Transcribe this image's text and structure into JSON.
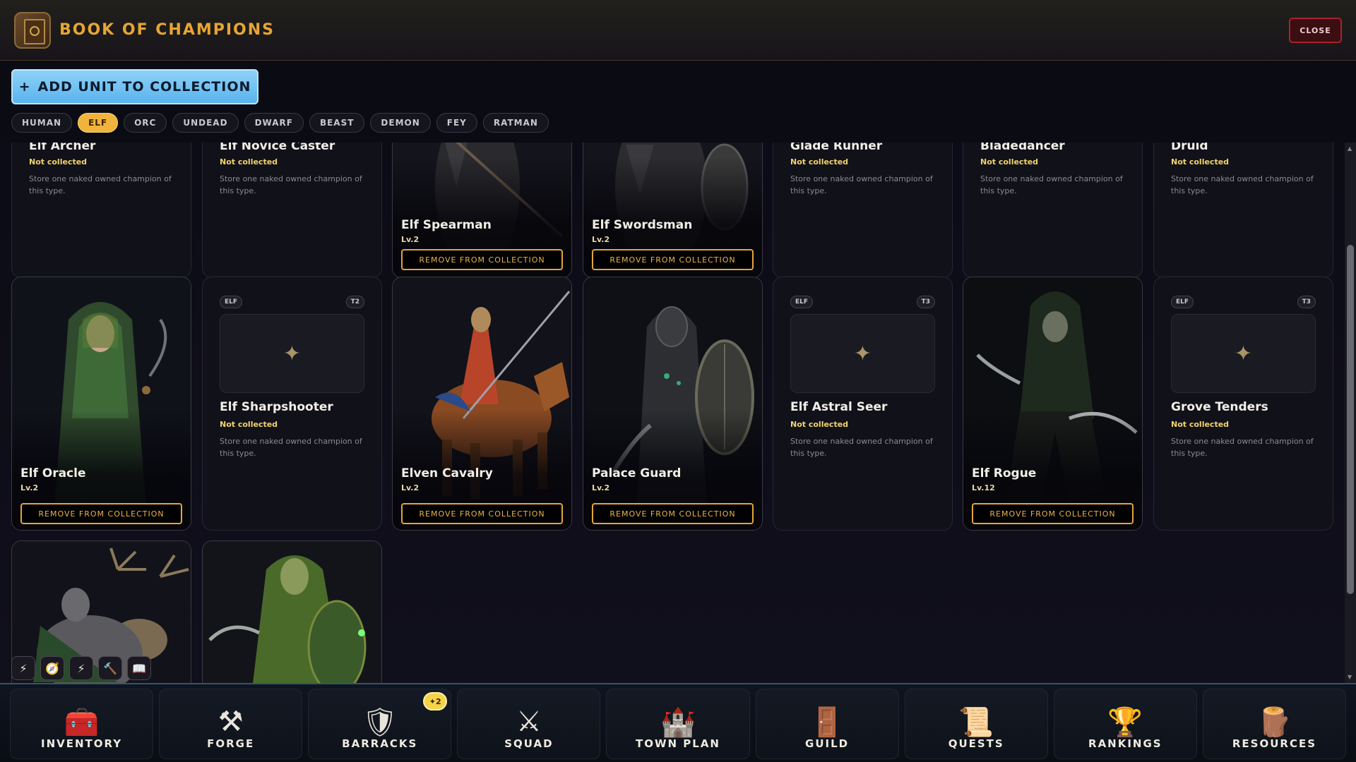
{
  "header": {
    "title": "BOOK OF CHAMPIONS",
    "close_label": "CLOSE"
  },
  "add_button": {
    "icon": "+",
    "label": "ADD UNIT TO COLLECTION"
  },
  "filters": [
    "HUMAN",
    "ELF",
    "ORC",
    "UNDEAD",
    "DWARF",
    "BEAST",
    "DEMON",
    "FEY",
    "RATMAN"
  ],
  "active_filter": "ELF",
  "remove_label": "REMOVE FROM COLLECTION",
  "not_collected_label": "Not collected",
  "empty_desc": "Store one naked owned champion of this type.",
  "placeholder_glyph": "✦",
  "cards_row1": [
    {
      "name": "Elf Archer",
      "owned": false
    },
    {
      "name": "Elf Novice Caster",
      "owned": false
    },
    {
      "name": "Elf Spearman",
      "owned": true,
      "level": "Lv.2"
    },
    {
      "name": "Elf Swordsman",
      "owned": true,
      "level": "Lv.2"
    },
    {
      "name": "Glade Runner",
      "owned": false
    },
    {
      "name": "Bladedancer",
      "owned": false
    },
    {
      "name": "Druid",
      "owned": false
    }
  ],
  "cards_row2": [
    {
      "name": "Elf Oracle",
      "owned": true,
      "level": "Lv.2"
    },
    {
      "name": "Elf Sharpshooter",
      "owned": false,
      "race_tag": "ELF",
      "tier_tag": "T2"
    },
    {
      "name": "Elven Cavalry",
      "owned": true,
      "level": "Lv.2"
    },
    {
      "name": "Palace Guard",
      "owned": true,
      "level": "Lv.2"
    },
    {
      "name": "Elf Astral Seer",
      "owned": false,
      "race_tag": "ELF",
      "tier_tag": "T3"
    },
    {
      "name": "Elf Rogue",
      "owned": true,
      "level": "Lv.12"
    },
    {
      "name": "Grove Tenders",
      "owned": false,
      "race_tag": "ELF",
      "tier_tag": "T3"
    }
  ],
  "quickbar": [
    {
      "icon": "lightning-icon",
      "glyph": "⚡"
    },
    {
      "icon": "compass-icon",
      "glyph": "🧭"
    },
    {
      "icon": "lightning-icon",
      "glyph": "⚡"
    },
    {
      "icon": "hammer-icon",
      "glyph": "🔨"
    },
    {
      "icon": "book-icon",
      "glyph": "📖"
    }
  ],
  "nav": [
    {
      "label": "INVENTORY",
      "icon": "chest-icon",
      "glyph": "🧰"
    },
    {
      "label": "FORGE",
      "icon": "anvil-icon",
      "glyph": "⚒"
    },
    {
      "label": "BARRACKS",
      "icon": "shield-swords-icon",
      "glyph": "🛡",
      "badge": "✦2"
    },
    {
      "label": "SQUAD",
      "icon": "squad-icon",
      "glyph": "⚔"
    },
    {
      "label": "TOWN PLAN",
      "icon": "castle-icon",
      "glyph": "🏰"
    },
    {
      "label": "GUILD",
      "icon": "gate-icon",
      "glyph": "🚪"
    },
    {
      "label": "QUESTS",
      "icon": "scroll-icon",
      "glyph": "📜"
    },
    {
      "label": "RANKINGS",
      "icon": "trophy-icon",
      "glyph": "🏆"
    },
    {
      "label": "RESOURCES",
      "icon": "logs-icon",
      "glyph": "🪵"
    }
  ],
  "colors": {
    "accent_gold": "#e7a534",
    "add_button_blue": "#5ab3ee",
    "close_red": "#a8222c",
    "not_collected": "#f2d36a"
  }
}
